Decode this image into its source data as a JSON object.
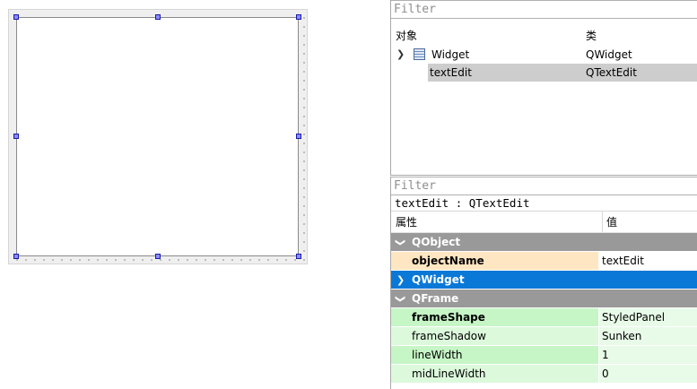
{
  "object_inspector": {
    "filter_placeholder": "Filter",
    "col_object": "对象",
    "col_class": "类",
    "rows": [
      {
        "name": "Widget",
        "class": "QWidget"
      },
      {
        "name": "textEdit",
        "class": "QTextEdit"
      }
    ]
  },
  "property_editor": {
    "filter_placeholder": "Filter",
    "current": "textEdit : QTextEdit",
    "col_property": "属性",
    "col_value": "值",
    "rows": [
      {
        "label": "QObject",
        "value": ""
      },
      {
        "label": "objectName",
        "value": "textEdit"
      },
      {
        "label": "QWidget",
        "value": ""
      },
      {
        "label": "QFrame",
        "value": ""
      },
      {
        "label": "frameShape",
        "value": "StyledPanel"
      },
      {
        "label": "frameShadow",
        "value": "Sunken"
      },
      {
        "label": "lineWidth",
        "value": "1"
      },
      {
        "label": "midLineWidth",
        "value": "0"
      }
    ]
  },
  "colors": {
    "group_gray": "#999999",
    "group_selected": "#0a78d7",
    "modified_row": "#ffe6c2",
    "qframe_rows": "#c6f5c6"
  }
}
